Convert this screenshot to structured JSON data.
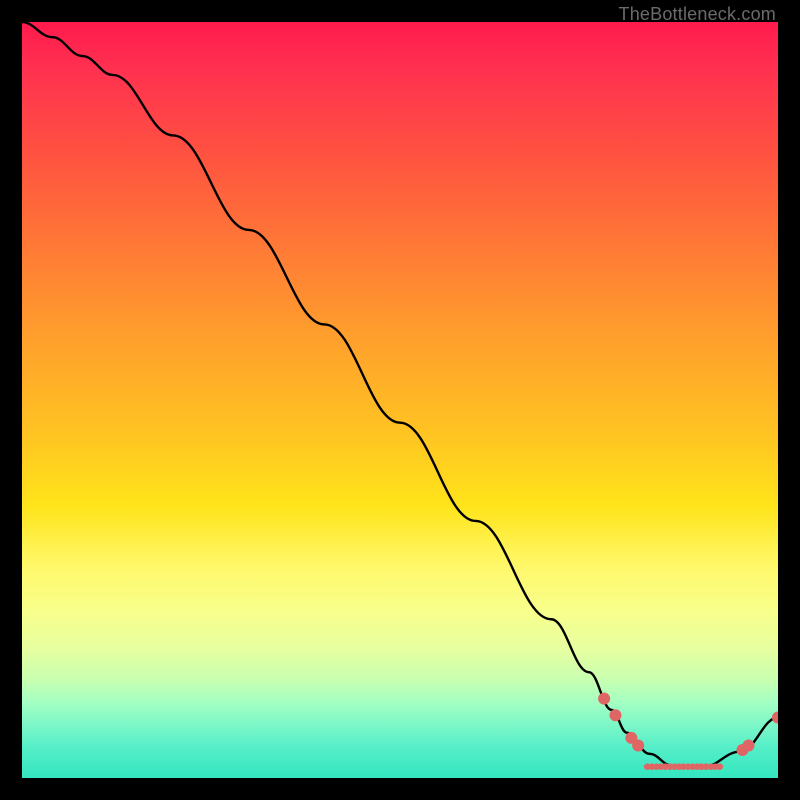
{
  "watermark": "TheBottleneck.com",
  "chart_data": {
    "type": "line",
    "title": "",
    "xlabel": "",
    "ylabel": "",
    "xlim": [
      0,
      100
    ],
    "ylim": [
      0,
      100
    ],
    "series": [
      {
        "name": "curve",
        "x": [
          0,
          4,
          8,
          12,
          20,
          30,
          40,
          50,
          60,
          70,
          75,
          78,
          80,
          83,
          86,
          90,
          95,
          100
        ],
        "y": [
          100,
          98,
          95.5,
          93,
          85,
          72.5,
          60,
          47,
          34,
          21,
          14,
          9,
          6,
          3.2,
          1.6,
          1.4,
          3.5,
          8
        ]
      }
    ],
    "markers": [
      {
        "x": 77,
        "y": 10.5,
        "r": 6
      },
      {
        "x": 78.5,
        "y": 8.3,
        "r": 6
      },
      {
        "x": 80.6,
        "y": 5.3,
        "r": 6
      },
      {
        "x": 81.5,
        "y": 4.3,
        "r": 6
      },
      {
        "x": 95.3,
        "y": 3.7,
        "r": 6
      },
      {
        "x": 96.1,
        "y": 4.3,
        "r": 6
      },
      {
        "x": 100,
        "y": 8,
        "r": 6
      },
      {
        "x": 82.7,
        "y": 1.5,
        "r": 3.3
      },
      {
        "x": 83.3,
        "y": 1.5,
        "r": 3.3
      },
      {
        "x": 83.9,
        "y": 1.5,
        "r": 3.3
      },
      {
        "x": 84.5,
        "y": 1.5,
        "r": 3.3
      },
      {
        "x": 85.1,
        "y": 1.5,
        "r": 3.3
      },
      {
        "x": 85.7,
        "y": 1.5,
        "r": 3.3
      },
      {
        "x": 86.3,
        "y": 1.5,
        "r": 3.3
      },
      {
        "x": 86.9,
        "y": 1.5,
        "r": 3.3
      },
      {
        "x": 87.5,
        "y": 1.5,
        "r": 3.3
      },
      {
        "x": 88.1,
        "y": 1.5,
        "r": 3.3
      },
      {
        "x": 88.7,
        "y": 1.5,
        "r": 3.3
      },
      {
        "x": 89.3,
        "y": 1.5,
        "r": 3.3
      },
      {
        "x": 89.9,
        "y": 1.5,
        "r": 3.3
      },
      {
        "x": 90.5,
        "y": 1.5,
        "r": 3.3
      },
      {
        "x": 91.1,
        "y": 1.5,
        "r": 3.3
      },
      {
        "x": 91.7,
        "y": 1.5,
        "r": 3.3
      },
      {
        "x": 92.3,
        "y": 1.5,
        "r": 3.3
      }
    ],
    "colors": {
      "curve": "#000000",
      "marker": "#e06666"
    }
  }
}
